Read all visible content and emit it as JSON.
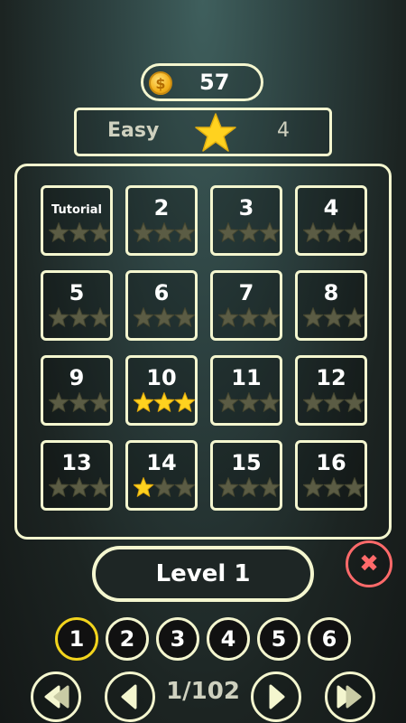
{
  "coins": {
    "count": "57",
    "icon": "coin-icon",
    "symbol": "$"
  },
  "difficulty": {
    "label": "Easy",
    "star_icon": "star-icon",
    "count": "4"
  },
  "levels": [
    {
      "label": "Tutorial",
      "stars": 0
    },
    {
      "label": "2",
      "stars": 0
    },
    {
      "label": "3",
      "stars": 0
    },
    {
      "label": "4",
      "stars": 0
    },
    {
      "label": "5",
      "stars": 0
    },
    {
      "label": "6",
      "stars": 0
    },
    {
      "label": "7",
      "stars": 0
    },
    {
      "label": "8",
      "stars": 0
    },
    {
      "label": "9",
      "stars": 0
    },
    {
      "label": "10",
      "stars": 3
    },
    {
      "label": "11",
      "stars": 0
    },
    {
      "label": "12",
      "stars": 0
    },
    {
      "label": "13",
      "stars": 0
    },
    {
      "label": "14",
      "stars": 1
    },
    {
      "label": "15",
      "stars": 0
    },
    {
      "label": "16",
      "stars": 0
    }
  ],
  "level_bar": {
    "label": "Level 1"
  },
  "close_button": {
    "symbol": "✖"
  },
  "pages": [
    "1",
    "2",
    "3",
    "4",
    "5",
    "6"
  ],
  "active_page": "1",
  "pagination": {
    "indicator": "1/102"
  },
  "colors": {
    "star_earned": "#ffd21f",
    "star_empty": "#5b5c44",
    "border": "#f4f6cf",
    "active_page": "#f2d41d",
    "close": "#ff6a6a"
  }
}
